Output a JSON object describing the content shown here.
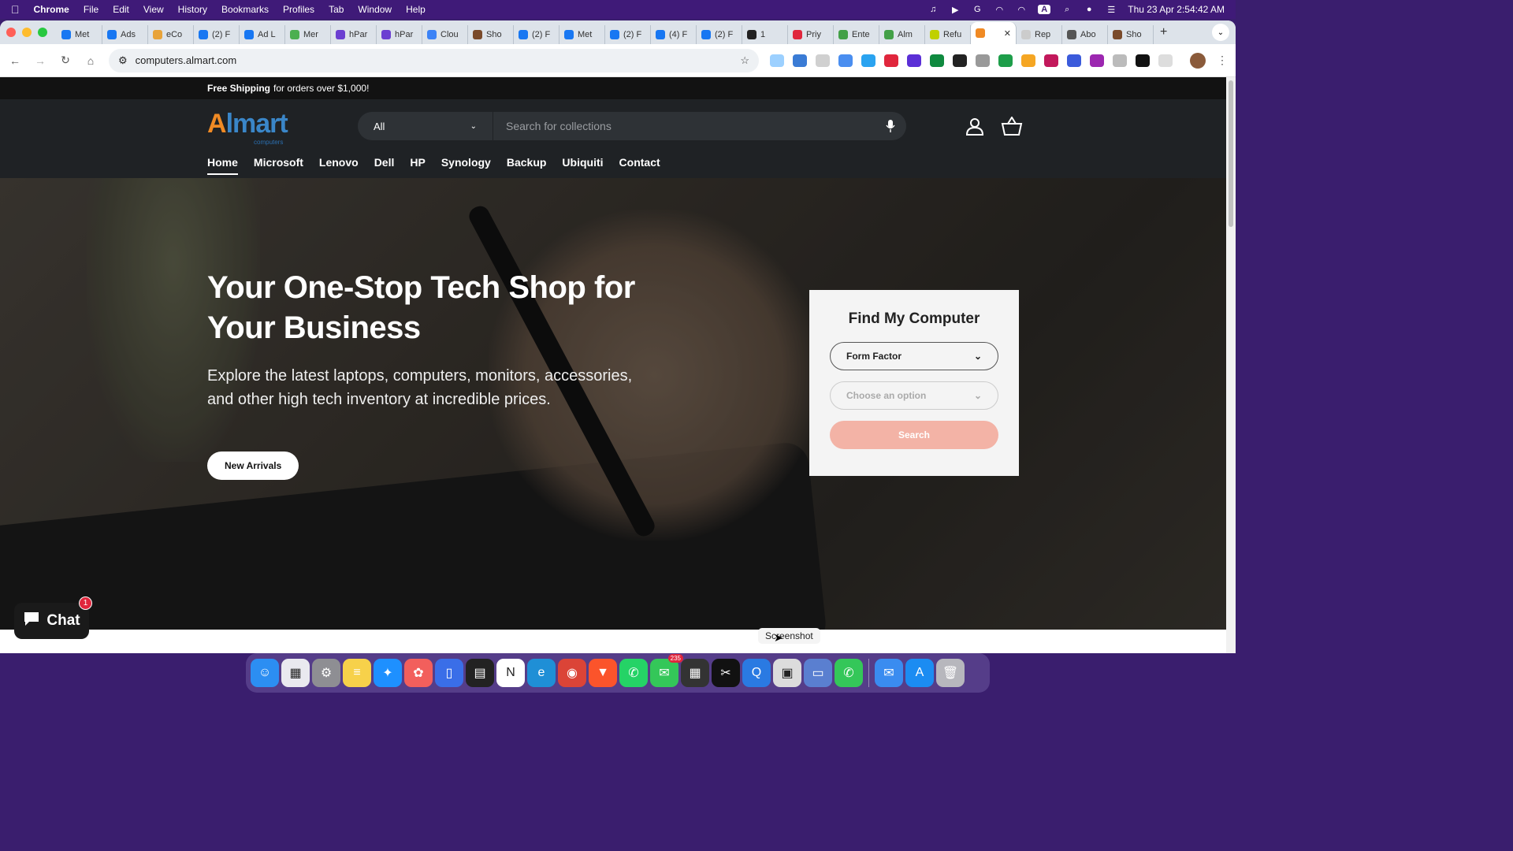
{
  "menubar": {
    "apple": "",
    "items": [
      "Chrome",
      "File",
      "Edit",
      "View",
      "History",
      "Bookmarks",
      "Profiles",
      "Tab",
      "Window",
      "Help"
    ],
    "datetime": "Thu 23 Apr  2:54:42 AM",
    "input_indicator": "A"
  },
  "browser": {
    "tabs": [
      {
        "label": "Met",
        "color": "#1877f2"
      },
      {
        "label": "Ads",
        "color": "#1877f2"
      },
      {
        "label": "eCo",
        "color": "#e8a33a"
      },
      {
        "label": "(2) F",
        "color": "#1877f2"
      },
      {
        "label": "Ad L",
        "color": "#1877f2"
      },
      {
        "label": "Mer",
        "color": "#4caf50"
      },
      {
        "label": "hPar",
        "color": "#6b3fd1"
      },
      {
        "label": "hPar",
        "color": "#6b3fd1"
      },
      {
        "label": "Clou",
        "color": "#3b82f6"
      },
      {
        "label": "Sho",
        "color": "#7a4a2a"
      },
      {
        "label": "(2) F",
        "color": "#1877f2"
      },
      {
        "label": "Met",
        "color": "#1877f2"
      },
      {
        "label": "(2) F",
        "color": "#1877f2"
      },
      {
        "label": "(4) F",
        "color": "#1877f2"
      },
      {
        "label": "(2) F",
        "color": "#1877f2"
      },
      {
        "label": "1",
        "color": "#222222"
      },
      {
        "label": "Priy",
        "color": "#e0263c"
      },
      {
        "label": "Ente",
        "color": "#43a047"
      },
      {
        "label": "Alm",
        "color": "#43a047"
      },
      {
        "label": "Refu",
        "color": "#c0d000"
      },
      {
        "label": "",
        "color": "#f08a24",
        "active": true
      },
      {
        "label": "Rep",
        "color": "#cccccc"
      },
      {
        "label": "Abo",
        "color": "#555555"
      },
      {
        "label": "Sho",
        "color": "#7a4a2a"
      }
    ],
    "url": "computers.almart.com"
  },
  "announcement": {
    "bold": "Free Shipping",
    "rest": "for orders over $1,000!"
  },
  "header": {
    "logo": {
      "a": "A",
      "rest": "lmart",
      "sub": "computers"
    },
    "search": {
      "category": "All",
      "placeholder": "Search for collections"
    },
    "nav": [
      "Home",
      "Microsoft",
      "Lenovo",
      "Dell",
      "HP",
      "Synology",
      "Backup",
      "Ubiquiti",
      "Contact"
    ]
  },
  "hero": {
    "title": "Your One-Stop Tech Shop for Your Business",
    "subtitle": "Explore the latest laptops, computers, monitors, accessories, and other high tech inventory at incredible prices.",
    "cta": "New Arrivals"
  },
  "finder": {
    "title": "Find My Computer",
    "select1": "Form Factor",
    "select2": "Choose an option",
    "button": "Search"
  },
  "chat": {
    "label": "Chat",
    "badge": "1"
  },
  "tooltip": "Screenshot",
  "dock": {
    "apps": [
      {
        "name": "finder",
        "color": "#2c8ef2",
        "glyph": "☺"
      },
      {
        "name": "launchpad",
        "color": "#e9e9ef",
        "glyph": "▦"
      },
      {
        "name": "system-settings",
        "color": "#8e8e93",
        "glyph": "⚙"
      },
      {
        "name": "notes",
        "color": "#f7d14a",
        "glyph": "≡"
      },
      {
        "name": "safari",
        "color": "#1e90ff",
        "glyph": "✦"
      },
      {
        "name": "photos",
        "color": "#f25f5c",
        "glyph": "✿"
      },
      {
        "name": "preview",
        "color": "#3a6ee8",
        "glyph": "▯"
      },
      {
        "name": "mission-control",
        "color": "#222222",
        "glyph": "▤"
      },
      {
        "name": "notion",
        "color": "#ffffff",
        "glyph": "N"
      },
      {
        "name": "edge",
        "color": "#1f8fd6",
        "glyph": "e"
      },
      {
        "name": "chrome",
        "color": "#db4437",
        "glyph": "◉"
      },
      {
        "name": "brave",
        "color": "#fb542b",
        "glyph": "▼"
      },
      {
        "name": "whatsapp",
        "color": "#25d366",
        "glyph": "✆"
      },
      {
        "name": "messages",
        "color": "#34c759",
        "glyph": "✉",
        "badge": "235"
      },
      {
        "name": "calculator",
        "color": "#333333",
        "glyph": "▦"
      },
      {
        "name": "capcut",
        "color": "#111111",
        "glyph": "✂"
      },
      {
        "name": "qbittorrent",
        "color": "#2a7ae2",
        "glyph": "Q"
      },
      {
        "name": "screenshot",
        "color": "#dcdcdc",
        "glyph": "▣"
      },
      {
        "name": "migration",
        "color": "#5a7fd0",
        "glyph": "▭"
      },
      {
        "name": "phone",
        "color": "#34c759",
        "glyph": "✆"
      },
      {
        "name": "mail",
        "color": "#3a8cf0",
        "glyph": "✉"
      },
      {
        "name": "app-store",
        "color": "#1b8cf2",
        "glyph": "A"
      },
      {
        "name": "trash",
        "color": "#b7b7bd",
        "glyph": "🗑"
      }
    ]
  }
}
